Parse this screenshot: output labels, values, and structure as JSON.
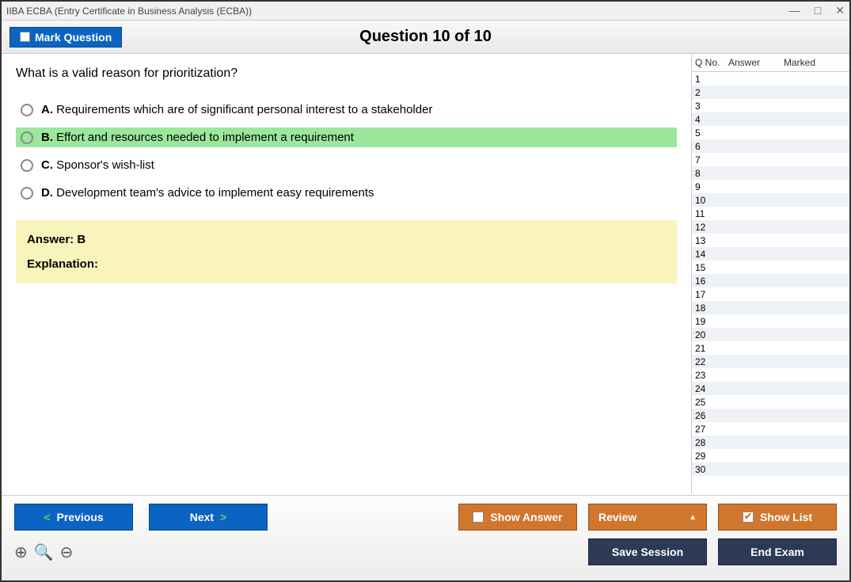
{
  "window": {
    "title": "IIBA ECBA (Entry Certificate in Business Analysis (ECBA))"
  },
  "topbar": {
    "mark_label": "Mark Question",
    "heading": "Question 10 of 10"
  },
  "question": {
    "text": "What is a valid reason for prioritization?",
    "options": [
      {
        "letter": "A.",
        "text": "Requirements which are of significant personal interest to a stakeholder",
        "correct": false
      },
      {
        "letter": "B.",
        "text": "Effort and resources needed to implement a requirement",
        "correct": true
      },
      {
        "letter": "C.",
        "text": "Sponsor's wish-list",
        "correct": false
      },
      {
        "letter": "D.",
        "text": "Development team's advice to implement easy requirements",
        "correct": false
      }
    ]
  },
  "answer_box": {
    "answer_label": "Answer: B",
    "explanation_label": "Explanation:"
  },
  "sidepanel": {
    "headers": {
      "qno": "Q No.",
      "answer": "Answer",
      "marked": "Marked"
    },
    "row_count": 30
  },
  "buttons": {
    "previous": "Previous",
    "next": "Next",
    "show_answer": "Show Answer",
    "review": "Review",
    "show_list": "Show List",
    "save_session": "Save Session",
    "end_exam": "End Exam"
  }
}
